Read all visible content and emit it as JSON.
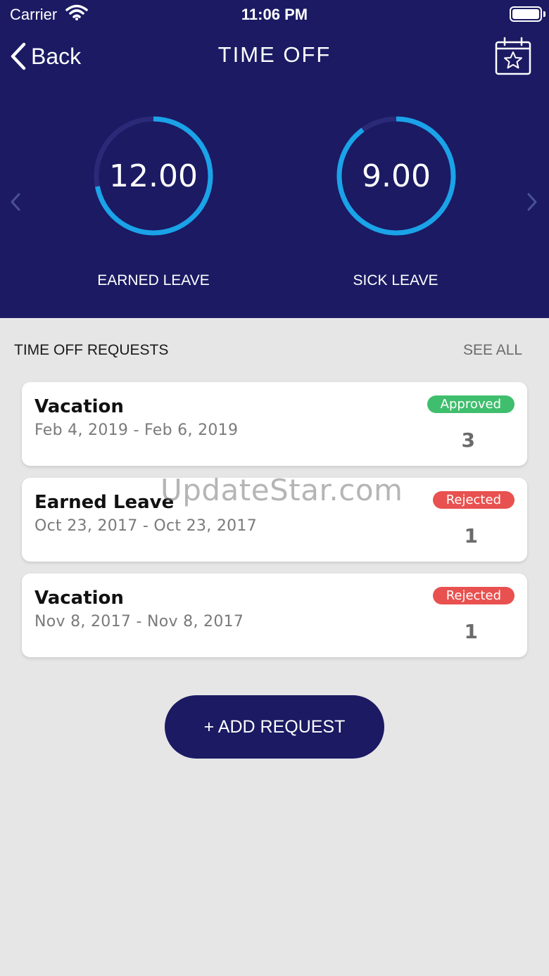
{
  "status_bar": {
    "carrier": "Carrier",
    "time": "11:06 PM"
  },
  "nav": {
    "back_label": "Back",
    "title": "TIME OFF",
    "calendar_icon": "calendar-star-icon"
  },
  "balances": [
    {
      "value": "12.00",
      "label": "EARNED LEAVE",
      "fill_fraction": 0.72
    },
    {
      "value": "9.00",
      "label": "SICK LEAVE",
      "fill_fraction": 0.9
    }
  ],
  "requests_section": {
    "title": "TIME OFF REQUESTS",
    "see_all": "SEE ALL"
  },
  "requests": [
    {
      "type": "Vacation",
      "dates": "Feb 4, 2019 - Feb 6, 2019",
      "status": "Approved",
      "days": "3"
    },
    {
      "type": "Earned Leave",
      "dates": "Oct 23, 2017 - Oct 23, 2017",
      "status": "Rejected",
      "days": "1"
    },
    {
      "type": "Vacation",
      "dates": "Nov 8, 2017 - Nov 8, 2017",
      "status": "Rejected",
      "days": "1"
    }
  ],
  "watermark": "UpdateStar.com",
  "add_button": "+ ADD REQUEST",
  "colors": {
    "header_bg": "#1b1a63",
    "ring_fill": "#1aa3e8",
    "ring_track": "#2a2a78",
    "approved": "#3fbe6d",
    "rejected": "#e8514f"
  }
}
